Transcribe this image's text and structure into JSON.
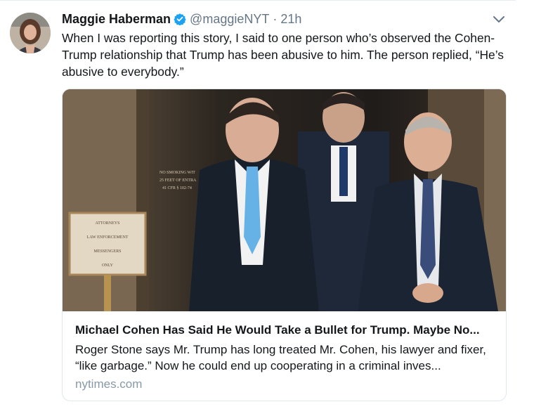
{
  "tweet": {
    "author_name": "Maggie Haberman",
    "handle": "@maggieNYT",
    "separator": "·",
    "timestamp": "21h",
    "text": "When I was reporting this story, I said to one person who’s observed the Cohen-Trump relationship that Trump has been abusive to him. The person replied, “He’s abusive to everybody.”"
  },
  "card": {
    "title": "Michael Cohen Has Said He Would Take a Bullet for Trump. Maybe No...",
    "description": "Roger Stone says Mr. Trump has long treated Mr. Cohen, his lawyer and fixer, “like garbage.” Now he could end up cooperating in a criminal inves...",
    "domain": "nytimes.com",
    "image_signs": {
      "placard_lines": [
        "ATTORNEYS",
        "LAW ENFORCEMENT",
        "MESSENGERS",
        "ONLY"
      ],
      "wall_sign_lines": [
        "NO SMOKING WIT",
        "25 FEET OF ENTRA",
        "41 CFR § 102-74"
      ]
    }
  },
  "icons": {
    "verified": "verified-badge-icon",
    "caret": "chevron-down-icon"
  },
  "colors": {
    "verified_blue": "#1da1f2",
    "secondary_text": "#657786",
    "card_border": "#e1e8ed"
  }
}
